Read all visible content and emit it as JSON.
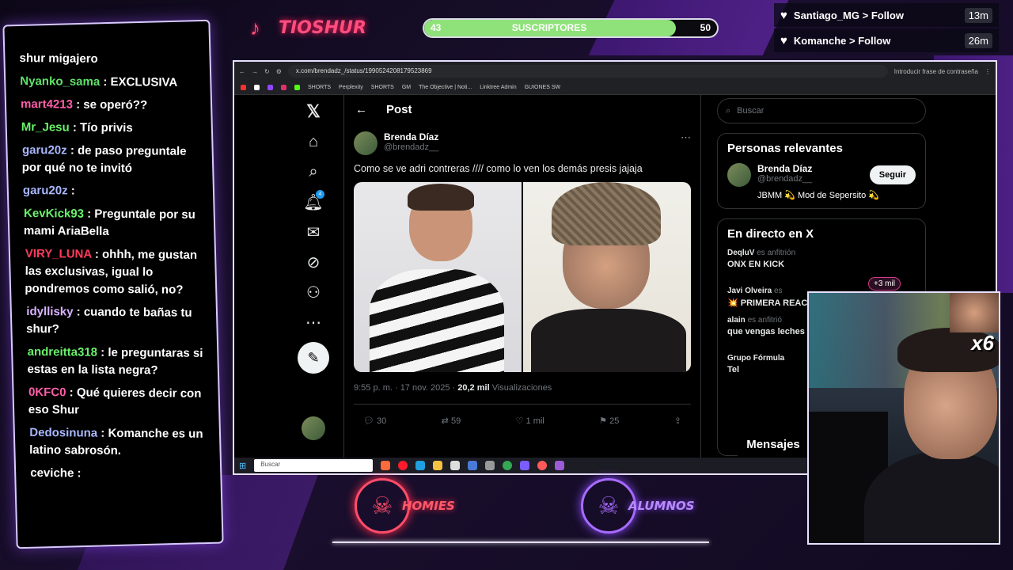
{
  "colors": {
    "accent_pink": "#ff4d7d",
    "accent_purple": "#a86bff",
    "sub_fill": "#8fe27a"
  },
  "brand": {
    "name": "TIOSHUR",
    "icon": "tiktok-icon"
  },
  "subs": {
    "current": "43",
    "label": "SUSCRIPTORES",
    "goal": "50",
    "progress": 0.86
  },
  "follows": [
    {
      "user": "Santiago_MG",
      "action": "> Follow",
      "time": "13m"
    },
    {
      "user": "Komanche",
      "action": "> Follow",
      "time": "26m"
    }
  ],
  "chat": [
    {
      "user": "",
      "text": "shur migajero",
      "color": "#ffffff"
    },
    {
      "user": "Nyanko_sama",
      "text": ": EXCLUSIVA",
      "color": "#5fe36a"
    },
    {
      "user": "mart4213",
      "text": ": se operó??",
      "color": "#ff5ea8"
    },
    {
      "user": "Mr_Jesu",
      "text": ": Tío privis",
      "color": "#6af26a"
    },
    {
      "user": "garu20z",
      "text": ": de paso preguntale por qué no te invitó",
      "color": "#a9b8ff"
    },
    {
      "user": "garu20z",
      "text": ":",
      "color": "#a9b8ff"
    },
    {
      "user": "KevKick93",
      "text": ": Preguntale por su mami AriaBella",
      "color": "#6af26a"
    },
    {
      "user": "VIRY_LUNA",
      "text": ": ohhh, me gustan las exclusivas, igual lo pondremos como salió, no?",
      "color": "#ff3b5c"
    },
    {
      "user": "idyllisky",
      "text": ": cuando te bañas tu shur?",
      "color": "#d9b3ff"
    },
    {
      "user": "andreitta318",
      "text": ": le preguntaras si estas en la lista negra?",
      "color": "#6af26a"
    },
    {
      "user": "0KFC0",
      "text": ": Qué quieres decir con eso Shur",
      "color": "#ff5ea8"
    },
    {
      "user": "Dedosinuna",
      "text": ": Komanche es un latino sabrosón.",
      "color": "#a9b8ff"
    },
    {
      "user": "",
      "text": "ceviche :",
      "color": "#ffffff"
    }
  ],
  "browser": {
    "url": "x.com/brendadz_/status/1990524208179523869",
    "password_hint": "Introducir frase de contraseña",
    "bookmarks": [
      "SHORTS",
      "Perplexity",
      "SHORTS",
      "GM",
      "The Objective | Noti...",
      "Linktree Admin",
      "GUIONES SW"
    ],
    "taskbar_search": "Buscar"
  },
  "x": {
    "header": "Post",
    "notification_count": "4",
    "author_name": "Brenda Díaz",
    "author_handle": "@brendadz__",
    "text": "Como se ve adri contreras //// como lo ven los demás presis jajaja",
    "time": "9:55 p. m. · 17 nov. 2025 ·",
    "views": "20,2 mil",
    "views_label": "Visualizaciones",
    "replies": "30",
    "reposts": "59",
    "likes": "1 mil",
    "bookmarks": "25",
    "search_placeholder": "Buscar",
    "relevant_title": "Personas relevantes",
    "relevant_name": "Brenda Díaz",
    "relevant_handle": "@brendadz__",
    "relevant_bio": "JBMM 💫 Mod de Sepersito 💫",
    "follow_label": "Seguir",
    "live_title": "En directo en X",
    "live": [
      {
        "host": "DeqluV",
        "role": "es anfitrión",
        "title": "ONX EN KICK",
        "extra": "+3 mil"
      },
      {
        "host": "Javi Olveira",
        "role": "es",
        "title": "💥 PRIMERA REAC GLORIA CAMILA A",
        "extra": ""
      },
      {
        "host": "alain",
        "role": "es anfitrió",
        "title": "que vengas leches",
        "extra": ""
      },
      {
        "host": "Grupo Fórmula",
        "role": "",
        "title": "Tel",
        "extra": ""
      }
    ],
    "messages_label": "Mensajes"
  },
  "overlay": {
    "multiplier": "x6",
    "logo_left": "HOMIES",
    "logo_right": "ALUMNOS"
  }
}
